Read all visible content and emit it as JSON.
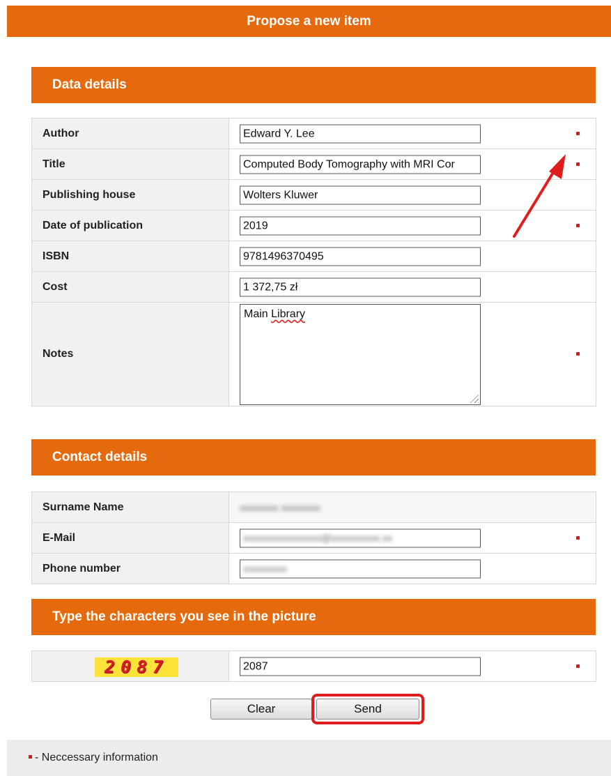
{
  "header": {
    "title": "Propose a new item"
  },
  "data_section": {
    "title": "Data details",
    "fields": [
      {
        "label": "Author",
        "value": "Edward Y. Lee",
        "required": true
      },
      {
        "label": "Title",
        "value": "Computed Body Tomography with MRI Cor",
        "required": true
      },
      {
        "label": "Publishing house",
        "value": "Wolters Kluwer",
        "required": false
      },
      {
        "label": "Date of publication",
        "value": "2019",
        "required": true
      },
      {
        "label": "ISBN",
        "value": "9781496370495",
        "required": false
      },
      {
        "label": "Cost",
        "value": "1 372,75 zł",
        "required": false
      },
      {
        "label": "Notes",
        "value_prefix": "Main ",
        "value_misspelled": "Library",
        "required": true
      }
    ]
  },
  "contact_section": {
    "title": "Contact details",
    "fields": [
      {
        "label": "Surname Name",
        "value": "xxxxxxxx xxxxxxxx",
        "required": false
      },
      {
        "label": "E-Mail",
        "value": "xxxxxxxxxxxxxxxx@xxxxxxxxxx.xx",
        "required": true
      },
      {
        "label": "Phone number",
        "value": "xxxxxxxxx",
        "required": false
      }
    ]
  },
  "captcha_section": {
    "title": "Type the characters you see in the picture",
    "image_text": "2087",
    "answer": "2087"
  },
  "buttons": {
    "clear": "Clear",
    "send": "Send"
  },
  "footer": {
    "legend": "- Neccessary information"
  },
  "colors": {
    "accent": "#e5690d",
    "required_marker": "#d21b1b",
    "highlight": "#e01c1c"
  }
}
